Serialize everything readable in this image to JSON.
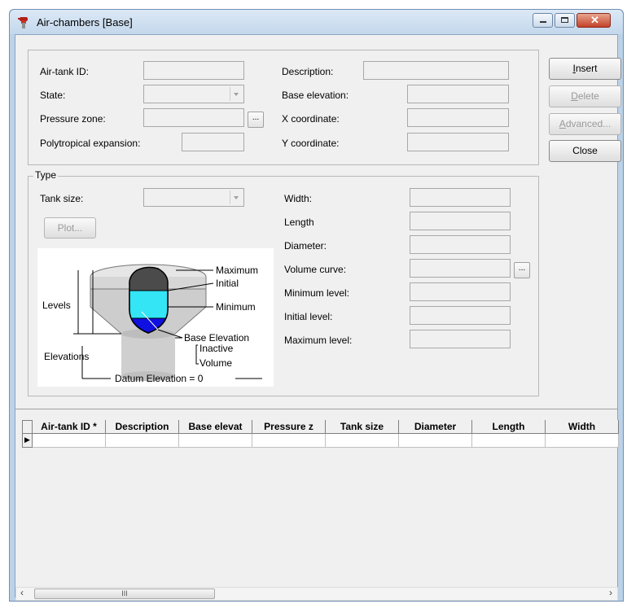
{
  "window": {
    "title": "Air-chambers [Base]",
    "icons": {
      "app": "tap-valve-icon",
      "minimize": "minimize-icon",
      "maximize": "maximize-icon",
      "close": "close-icon"
    }
  },
  "fields": {
    "air_tank_id": {
      "label": "Air-tank ID:",
      "value": ""
    },
    "state": {
      "label": "State:",
      "value": ""
    },
    "pressure_zone": {
      "label": "Pressure zone:",
      "value": "",
      "browse": "..."
    },
    "polytropical": {
      "label": "Polytropical expansion:",
      "value": ""
    },
    "description": {
      "label": "Description:",
      "value": ""
    },
    "base_elevation": {
      "label": "Base elevation:",
      "value": ""
    },
    "x_coordinate": {
      "label": "X coordinate:",
      "value": ""
    },
    "y_coordinate": {
      "label": "Y coordinate:",
      "value": ""
    }
  },
  "type_group": {
    "legend": "Type",
    "tank_size": {
      "label": "Tank size:",
      "value": ""
    },
    "plot_button": "Plot...",
    "width": {
      "label": "Width:",
      "value": ""
    },
    "length": {
      "label": "Length",
      "value": ""
    },
    "diameter": {
      "label": "Diameter:",
      "value": ""
    },
    "volume_curve": {
      "label": "Volume curve:",
      "value": "",
      "browse": "..."
    },
    "minimum_level": {
      "label": "Minimum level:",
      "value": ""
    },
    "initial_level": {
      "label": "Initial level:",
      "value": ""
    },
    "maximum_level": {
      "label": "Maximum level:",
      "value": ""
    }
  },
  "diagram": {
    "maximum": "Maximum",
    "initial": "Initial",
    "minimum": "Minimum",
    "levels": "Levels",
    "base_elevation": "Base Elevation",
    "inactive": "Inactive",
    "volume": "Volume",
    "elevations": "Elevations",
    "datum": "Datum  Elevation = 0",
    "colors": {
      "water": "#33e5f5",
      "inactive": "#1010e0",
      "tank": "#c8c8c8"
    }
  },
  "buttons": {
    "insert": {
      "label": "Insert",
      "accelerator": "I"
    },
    "delete": {
      "label": "Delete",
      "accelerator": "D"
    },
    "advanced": {
      "label": "Advanced...",
      "accelerator": "A"
    },
    "close": {
      "label": "Close"
    }
  },
  "grid": {
    "columns": [
      "Air-tank ID *",
      "Description",
      "Base elevat",
      "Pressure z",
      "Tank size",
      "Diameter",
      "Length",
      "Width"
    ],
    "row_indicator": "▶",
    "rows": [
      [
        "",
        "",
        "",
        "",
        "",
        "",
        "",
        ""
      ]
    ]
  },
  "scrollbar": {
    "left": "‹",
    "right": "›",
    "grip": "III"
  }
}
